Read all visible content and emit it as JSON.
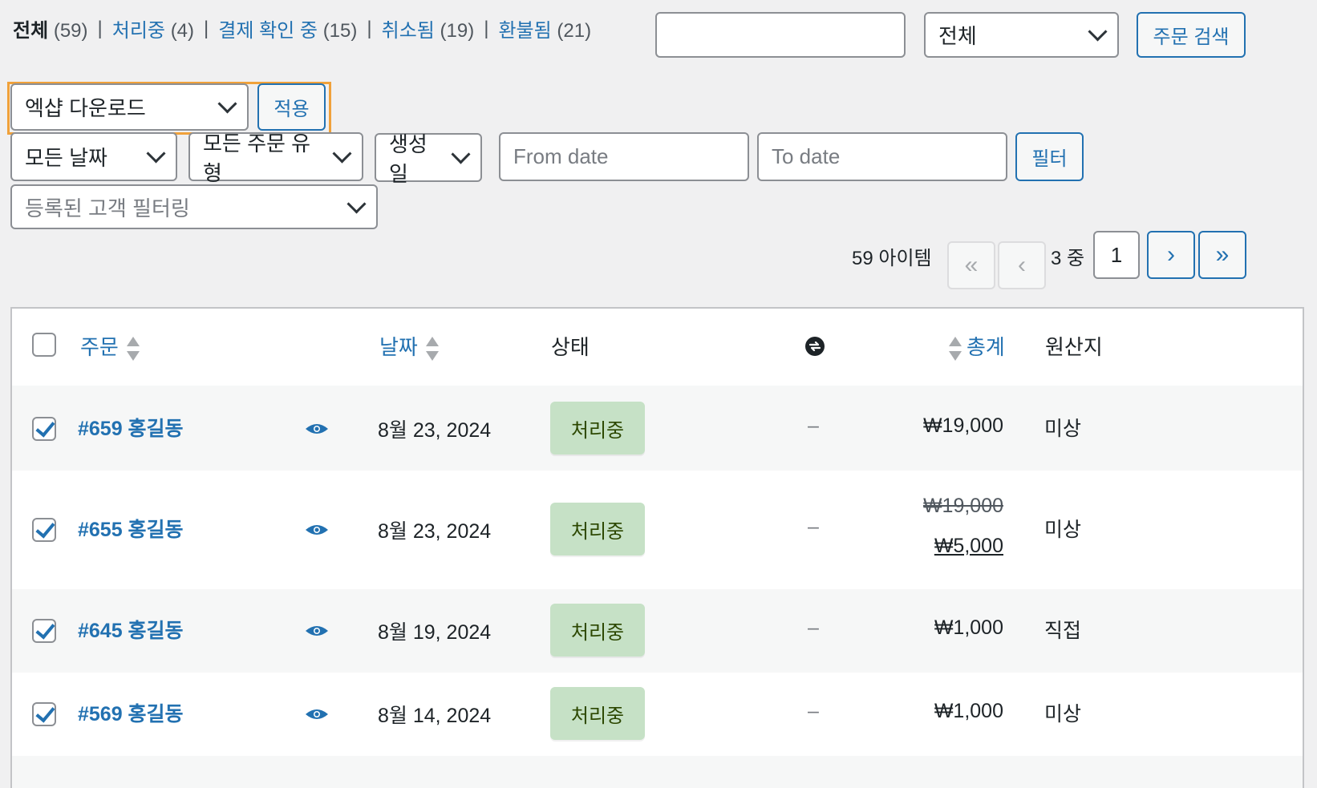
{
  "status_filters": [
    {
      "label": "전체",
      "count": "(59)",
      "current": true
    },
    {
      "label": "처리중",
      "count": "(4)"
    },
    {
      "label": "결제 확인 중",
      "count": "(15)"
    },
    {
      "label": "취소됨",
      "count": "(19)"
    },
    {
      "label": "환불됨",
      "count": "(21)"
    }
  ],
  "search": {
    "value": "",
    "scope_select": "전체",
    "button": "주문 검색"
  },
  "bulk": {
    "action": "엑샵 다운로드",
    "apply": "적용"
  },
  "filters": {
    "date": "모든 날짜",
    "order_type": "모든 주문 유형",
    "date_basis": "생성일",
    "from_placeholder": "From date",
    "to_placeholder": "To date",
    "filter_button": "필터",
    "customer_placeholder": "등록된 고객 필터링"
  },
  "pagination": {
    "items": "59 아이템",
    "first": "«",
    "prev": "‹",
    "total_pages": "3 중",
    "current_page": "1",
    "next": "›",
    "last": "»"
  },
  "table": {
    "headers": {
      "order": "주문",
      "date": "날짜",
      "status": "상태",
      "total": "총계",
      "origin": "원산지"
    },
    "rows": [
      {
        "order": "#659 홍길동",
        "date": "8월 23, 2024",
        "status": "처리중",
        "sub": "–",
        "total": "₩19,000",
        "origin": "미상"
      },
      {
        "order": "#655 홍길동",
        "date": "8월 23, 2024",
        "status": "처리중",
        "sub": "–",
        "total_old": "₩19,000",
        "total": "₩5,000",
        "origin": "미상"
      },
      {
        "order": "#645 홍길동",
        "date": "8월 19, 2024",
        "status": "처리중",
        "sub": "–",
        "total": "₩1,000",
        "origin": "직접"
      },
      {
        "order": "#569 홍길동",
        "date": "8월 14, 2024",
        "status": "처리중",
        "sub": "–",
        "total": "₩1,000",
        "origin": "미상"
      }
    ]
  }
}
